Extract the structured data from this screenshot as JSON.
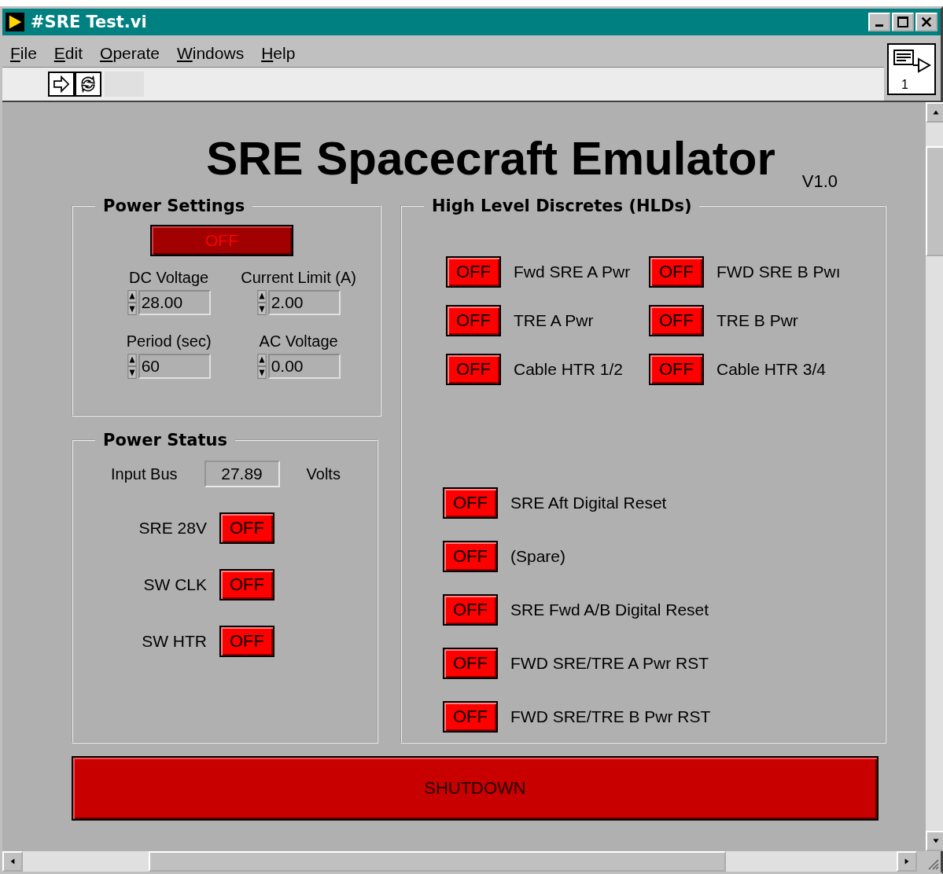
{
  "window": {
    "title": "#SRE Test.vi"
  },
  "menu": [
    "File",
    "Edit",
    "Operate",
    "Windows",
    "Help"
  ],
  "vi_icon": {
    "label": "1"
  },
  "heading": "SRE Spacecraft Emulator",
  "version": "V1.0",
  "power_settings": {
    "title": "Power Settings",
    "switch": {
      "label": "OFF",
      "on": false
    },
    "controls": [
      {
        "label": "DC Voltage",
        "value": "28.00"
      },
      {
        "label": "Current Limit (A)",
        "value": "2.00"
      },
      {
        "label": "Period (sec)",
        "value": "60"
      },
      {
        "label": "AC Voltage",
        "value": "0.00"
      }
    ]
  },
  "power_status": {
    "title": "Power Status",
    "input_bus": {
      "label": "Input Bus",
      "value": "27.89",
      "unit": "Volts"
    },
    "indicators": [
      {
        "label": "SRE 28V",
        "state": "OFF",
        "on": false
      },
      {
        "label": "SW CLK",
        "state": "OFF",
        "on": false
      },
      {
        "label": "SW HTR",
        "state": "OFF",
        "on": false
      }
    ]
  },
  "hlds": {
    "title": "High Level Discretes (HLDs)",
    "grid": [
      {
        "label": "Fwd SRE A Pwr",
        "state": "OFF",
        "on": false
      },
      {
        "label": "FWD SRE B Pwı",
        "state": "OFF",
        "on": false
      },
      {
        "label": "TRE A Pwr",
        "state": "OFF",
        "on": false
      },
      {
        "label": "TRE B Pwr",
        "state": "OFF",
        "on": false
      },
      {
        "label": "Cable HTR 1/2",
        "state": "OFF",
        "on": false
      },
      {
        "label": "Cable HTR 3/4",
        "state": "OFF",
        "on": false
      }
    ],
    "list": [
      {
        "label": "SRE Aft Digital Reset",
        "state": "OFF",
        "on": false
      },
      {
        "label": "(Spare)",
        "state": "OFF",
        "on": false
      },
      {
        "label": "SRE Fwd A/B Digital Reset",
        "state": "OFF",
        "on": false
      },
      {
        "label": "FWD SRE/TRE A Pwr RST",
        "state": "OFF",
        "on": false
      },
      {
        "label": "FWD SRE/TRE B Pwr RST",
        "state": "OFF",
        "on": false
      }
    ]
  },
  "shutdown": {
    "label": "SHUTDOWN"
  }
}
